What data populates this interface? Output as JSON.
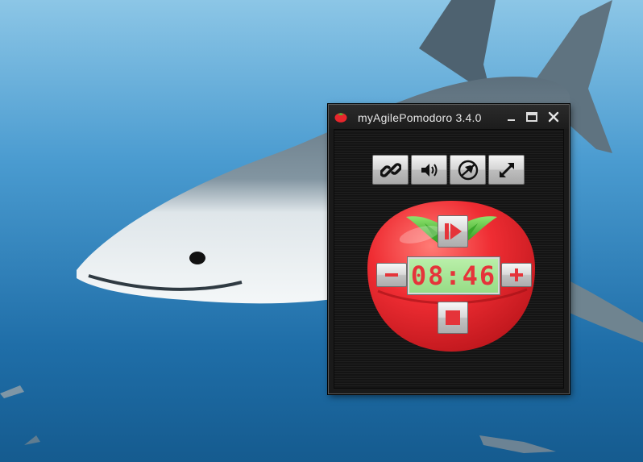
{
  "window": {
    "title": "myAgilePomodoro 3.4.0",
    "controls": {
      "minimize": "minimize",
      "maximize": "maximize",
      "close": "close"
    }
  },
  "toolbar": {
    "buttons": [
      {
        "icon": "link-icon"
      },
      {
        "icon": "speaker-icon"
      },
      {
        "icon": "pin-off-icon"
      },
      {
        "icon": "resize-arrows-icon"
      }
    ]
  },
  "timer": {
    "display": "08:46",
    "play_icon": "play-pause-icon",
    "stop_icon": "stop-icon",
    "minus_label": "−",
    "plus_label": "+"
  },
  "colors": {
    "tomato_red": "#e8262c",
    "leaf_green": "#4fb534",
    "lcd_green": "#a8e698",
    "lcd_digits": "#e5343a",
    "window_bg": "#1a1a1a"
  }
}
